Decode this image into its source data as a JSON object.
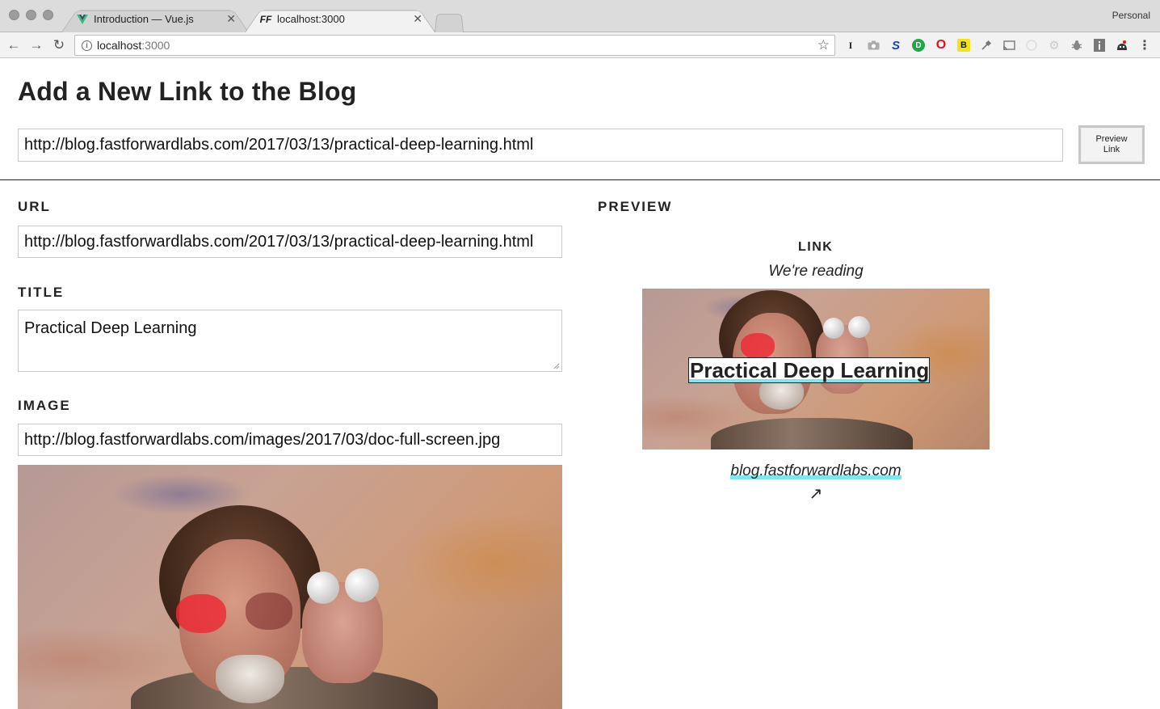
{
  "browser": {
    "tabs": [
      {
        "title": "Introduction — Vue.js",
        "favicon": "vue-icon",
        "active": false
      },
      {
        "title": "localhost:3000",
        "favicon": "ff-icon",
        "active": true
      }
    ],
    "profile": "Personal",
    "address": {
      "host": "localhost",
      "port": ":3000"
    },
    "extensions": [
      "instapaper-icon",
      "camera-icon",
      "s-icon",
      "d-icon",
      "opera-icon",
      "b-icon",
      "pin-icon",
      "cast-icon",
      "circle-icon",
      "gear-icon",
      "bug-icon",
      "info-icon",
      "ghost-icon",
      "menu-icon"
    ],
    "ext_glyphs": {
      "instapaper": "I",
      "s": "S",
      "d": "D",
      "opera": "O",
      "b": "B",
      "menu": "⋮"
    }
  },
  "page": {
    "title": "Add a New Link to the Blog",
    "url_entry_value": "http://blog.fastforwardlabs.com/2017/03/13/practical-deep-learning.html",
    "preview_button_label": "Preview Link"
  },
  "form": {
    "url_label": "URL",
    "url_value": "http://blog.fastforwardlabs.com/2017/03/13/practical-deep-learning.html",
    "title_label": "TITLE",
    "title_value": "Practical Deep Learning",
    "image_label": "IMAGE",
    "image_value": "http://blog.fastforwardlabs.com/images/2017/03/doc-full-screen.jpg"
  },
  "preview": {
    "label": "PREVIEW",
    "sub_label": "LINK",
    "reading": "We're reading",
    "card_title": "Practical Deep Learning",
    "domain": "blog.fastforwardlabs.com",
    "arrow": "↗"
  },
  "colors": {
    "highlight": "#7fe6f0",
    "text": "#222222",
    "lens_red": "#eb2d37"
  }
}
